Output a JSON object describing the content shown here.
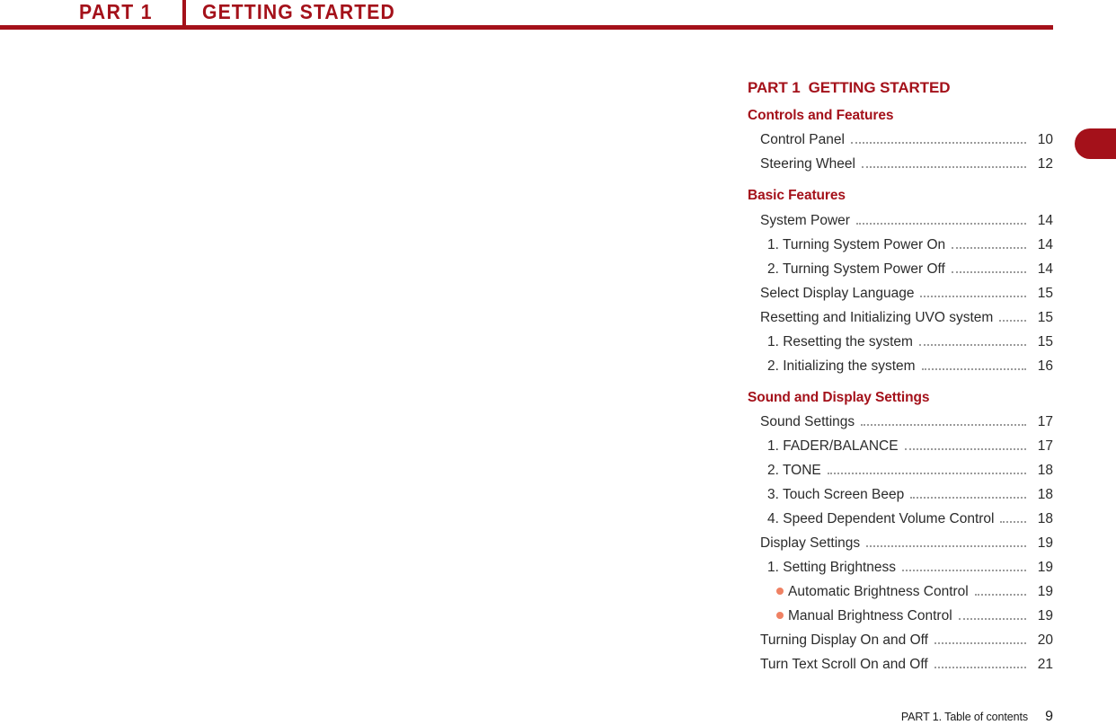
{
  "running_header": {
    "part": "PART 1",
    "title": "GETTING STARTED",
    "rule_color": "#a4111a"
  },
  "side_tab": {
    "color": "#a4111a"
  },
  "toc": {
    "title_part": "PART 1",
    "title_name": "GETTING STARTED",
    "accent_color": "#a4111a",
    "bullet_color": "#ef8163",
    "sections": [
      {
        "heading": "Controls and Features",
        "entries": [
          {
            "label": "Control Panel",
            "page": "10",
            "level": 1,
            "bullet": false
          },
          {
            "label": "Steering Wheel",
            "page": "12",
            "level": 1,
            "bullet": false
          }
        ]
      },
      {
        "heading": "Basic Features",
        "entries": [
          {
            "label": "System Power",
            "page": "14",
            "level": 1,
            "bullet": false
          },
          {
            "label": "1. Turning System Power On",
            "page": "14",
            "level": 2,
            "bullet": false
          },
          {
            "label": "2. Turning System Power Off",
            "page": "14",
            "level": 2,
            "bullet": false
          },
          {
            "label": "Select Display Language",
            "page": "15",
            "level": 1,
            "bullet": false
          },
          {
            "label": "Resetting and Initializing UVO system",
            "page": "15",
            "level": 1,
            "bullet": false
          },
          {
            "label": "1. Resetting the system",
            "page": "15",
            "level": 2,
            "bullet": false
          },
          {
            "label": "2. Initializing the system",
            "page": "16",
            "level": 2,
            "bullet": false
          }
        ]
      },
      {
        "heading": "Sound and Display Settings",
        "entries": [
          {
            "label": "Sound Settings",
            "page": "17",
            "level": 1,
            "bullet": false
          },
          {
            "label": "1. FADER/BALANCE",
            "page": "17",
            "level": 2,
            "bullet": false
          },
          {
            "label": "2. TONE",
            "page": "18",
            "level": 2,
            "bullet": false
          },
          {
            "label": "3. Touch Screen Beep",
            "page": "18",
            "level": 2,
            "bullet": false
          },
          {
            "label": "4. Speed Dependent Volume Control",
            "page": "18",
            "level": 2,
            "bullet": false
          },
          {
            "label": "Display Settings",
            "page": "19",
            "level": 1,
            "bullet": false
          },
          {
            "label": "1. Setting Brightness",
            "page": "19",
            "level": 2,
            "bullet": false
          },
          {
            "label": "Automatic Brightness Control",
            "page": "19",
            "level": 3,
            "bullet": true
          },
          {
            "label": "Manual Brightness Control",
            "page": "19",
            "level": 3,
            "bullet": true
          },
          {
            "label": "Turning Display On and Off",
            "page": "20",
            "level": 1,
            "bullet": false
          },
          {
            "label": "Turn Text Scroll On and Off",
            "page": "21",
            "level": 1,
            "bullet": false
          }
        ]
      }
    ]
  },
  "footer": {
    "label": "PART 1. Table of contents",
    "page": "9"
  }
}
